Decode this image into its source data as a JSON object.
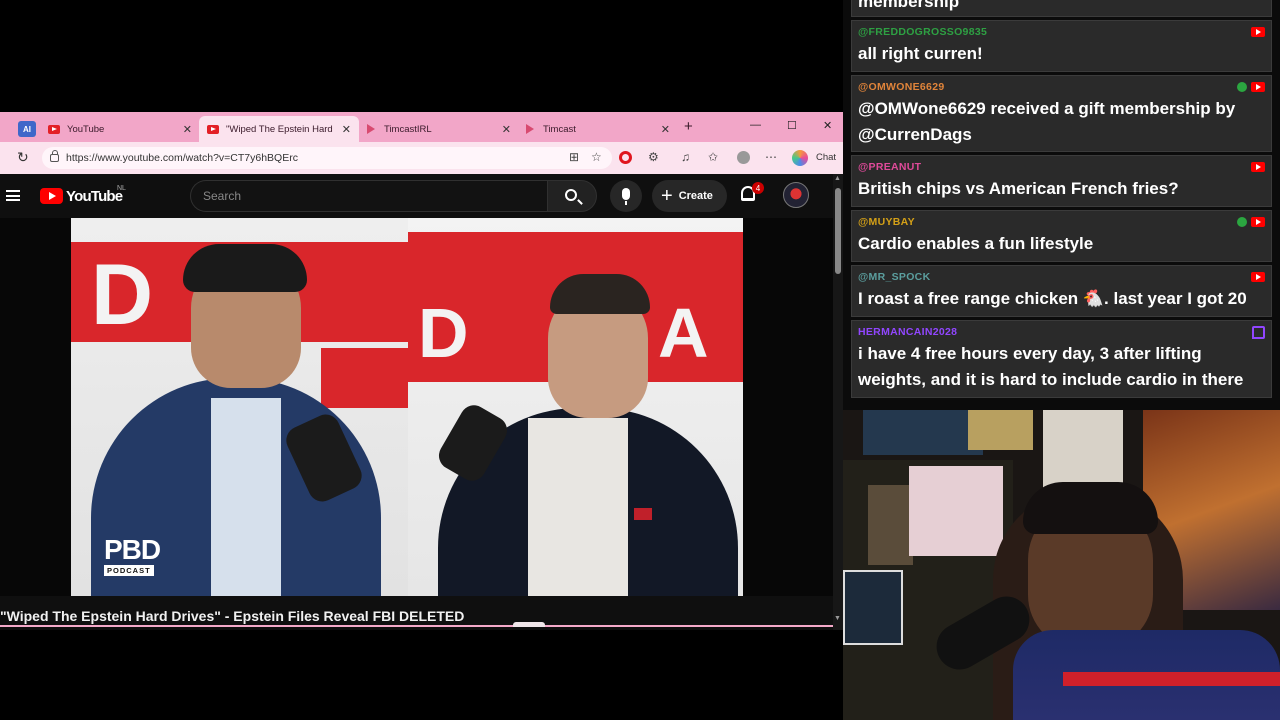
{
  "browser": {
    "tabs": [
      {
        "label": "YouTube",
        "favicon": "youtube-icon"
      },
      {
        "label": "\"Wiped The Epstein Hard Drives\" - Epstein Files Reveal FBI DELETED",
        "favicon": "youtube-icon",
        "active": true
      },
      {
        "label": "TimcastIRL",
        "favicon": "timcast-icon"
      },
      {
        "label": "Timcast",
        "favicon": "timcast-icon"
      }
    ],
    "ai_tab_label": "AI",
    "close_glyph": "✕",
    "new_tab_glyph": "+",
    "minimize_glyph": "—",
    "maximize_glyph": "☐",
    "window_close_glyph": "✕",
    "reload_glyph": "↻",
    "url": "https://www.youtube.com/watch?v=CT7y6hBQErc",
    "chat_button_label": "Chat"
  },
  "youtube": {
    "wordmark": "YouTube",
    "country_code": "NL",
    "search_placeholder": "Search",
    "create_label": "Create",
    "notification_count": "4",
    "video_title": "\"Wiped The Epstein Hard Drives\" - Epstein Files Reveal FBI DELETED",
    "video_logo": "PBD",
    "video_logo_sub": "PODCAST"
  },
  "chat": {
    "messages": [
      {
        "user": "",
        "text": "membership",
        "color": "#ffffff"
      },
      {
        "user": "@FREDDOGROSSO9835",
        "text": "all right curren!",
        "color": "#2ea043"
      },
      {
        "user": "@OMWONE6629",
        "text": "@OMWone6629 received a gift membership by @CurrenDags",
        "color": "#e0843a"
      },
      {
        "user": "@PREANUT",
        "text": "British chips vs American French fries?",
        "color": "#e04a9a"
      },
      {
        "user": "@MUYBAY",
        "text": "Cardio enables a fun lifestyle",
        "color": "#d4a017"
      },
      {
        "user": "@MR_SPOCK",
        "text": "I roast a free range chicken 🐔. last year I got 20",
        "color": "#5b9e9e"
      },
      {
        "user": "HERMANCAIN2028",
        "text": "i have 4 free hours every day, 3 after lifting weights, and it is hard to include cardio in there",
        "color": "#9146ff"
      }
    ]
  }
}
